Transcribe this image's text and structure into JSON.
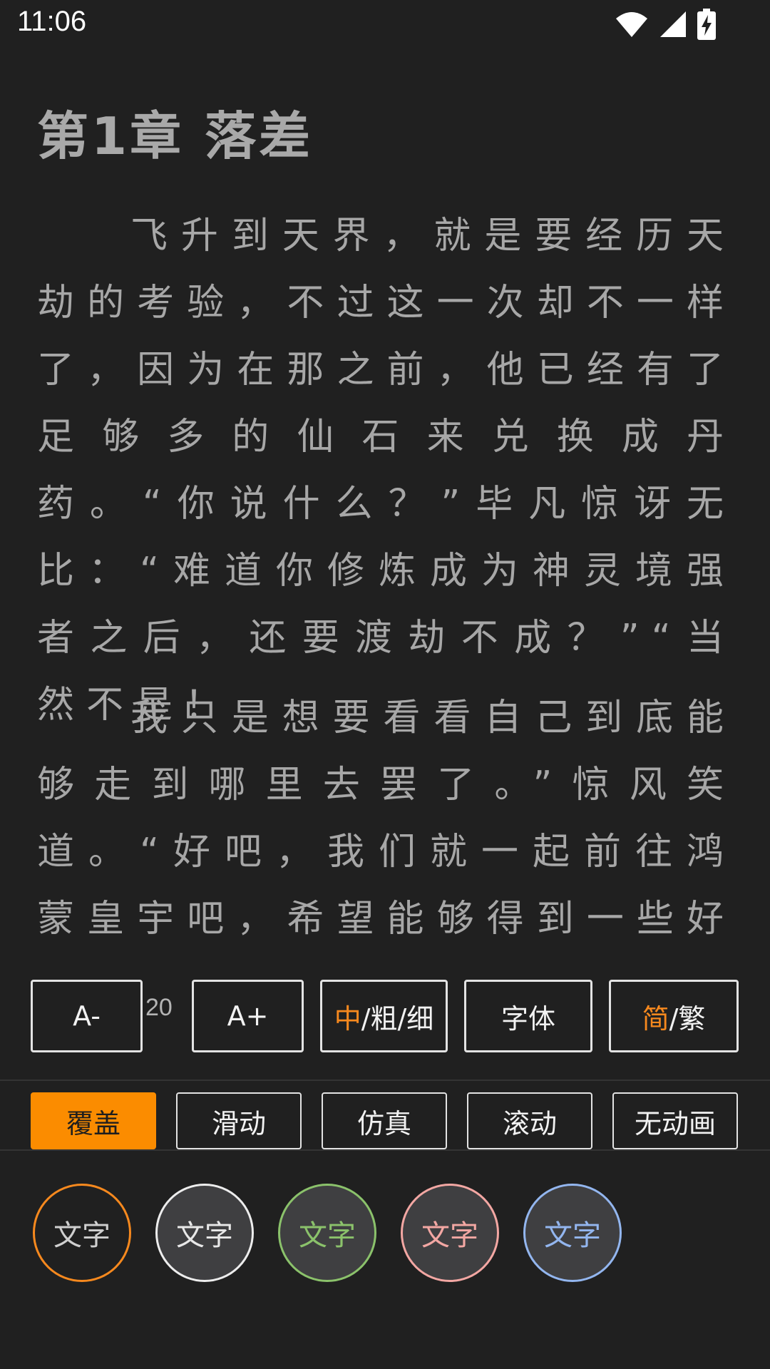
{
  "status_bar": {
    "time": "11:06",
    "icons": [
      "wifi-icon",
      "signal-icon",
      "battery-charging-icon"
    ]
  },
  "reader": {
    "chapter_title": "第1章 落差",
    "paragraphs": [
      "飞升到天界，就是要经历天劫的考验，不过这一次却不一样了，因为在那之前，他已经有了足够多的仙石来兑换成丹药。“你说什么？”毕凡惊讶无比：“难道你修炼成为神灵境强者之后，还要渡劫不成？”“当然不是！",
      "我只是想要看看自己到底能够走到哪里去罢了。”惊风笑道。“好吧，我们就一起前往鸿蒙皇宇吧，希望能够得到一些好处。”毕"
    ]
  },
  "settings": {
    "font_row": {
      "decrease_label": "A-",
      "size_value": "20",
      "increase_label": "A+",
      "weight": {
        "selected": "中",
        "rest": "/粗/细"
      },
      "font_label": "字体",
      "script": {
        "selected": "简",
        "rest": "/繁"
      }
    },
    "animation_row": {
      "items": [
        "覆盖",
        "滑动",
        "仿真",
        "滚动",
        "无动画"
      ],
      "selected_index": 0
    },
    "color_row": {
      "label": "文字",
      "themes": [
        {
          "text_color": "#cfcfcf",
          "border_color": "#f7891e",
          "background": "#202020"
        },
        {
          "text_color": "#e8e8e8",
          "border_color": "#ededed",
          "background": "#3f3f41"
        },
        {
          "text_color": "#8bc26b",
          "border_color": "#8bc26b",
          "background": "#3f3f41"
        },
        {
          "text_color": "#f3a7a3",
          "border_color": "#f3a7a3",
          "background": "#3f3f41"
        },
        {
          "text_color": "#93b6ef",
          "border_color": "#93b6ef",
          "background": "#3f3f41"
        }
      ]
    }
  },
  "colors": {
    "background": "#202020",
    "accent": "#fb8c00",
    "reader_text": "#a7a7a7"
  }
}
